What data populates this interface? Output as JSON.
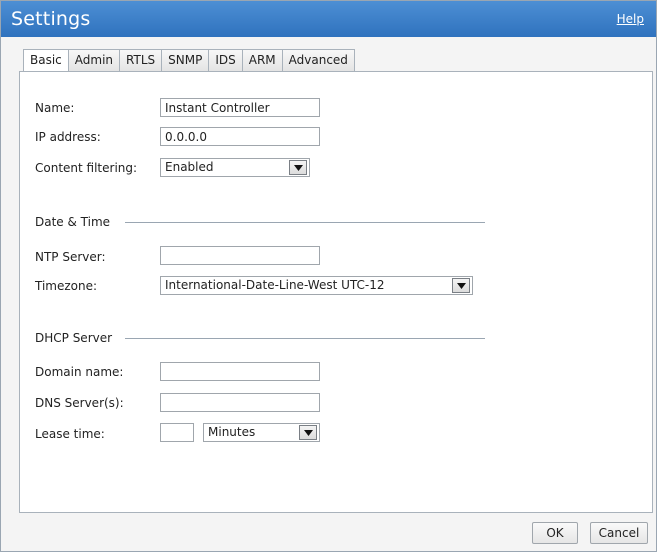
{
  "window": {
    "title": "Settings",
    "help_label": "Help"
  },
  "tabs": [
    {
      "label": "Basic",
      "active": true
    },
    {
      "label": "Admin"
    },
    {
      "label": "RTLS"
    },
    {
      "label": "SNMP"
    },
    {
      "label": "IDS"
    },
    {
      "label": "ARM"
    },
    {
      "label": "Advanced"
    }
  ],
  "basic": {
    "name_label": "Name:",
    "name_value": "Instant Controller",
    "ip_label": "IP address:",
    "ip_value": "0.0.0.0",
    "content_filtering_label": "Content filtering:",
    "content_filtering_value": "Enabled"
  },
  "date_time": {
    "section_title": "Date & Time",
    "ntp_label": "NTP Server:",
    "ntp_value": "",
    "timezone_label": "Timezone:",
    "timezone_value": "International-Date-Line-West UTC-12"
  },
  "dhcp": {
    "section_title": "DHCP Server",
    "domain_label": "Domain name:",
    "domain_value": "",
    "dns_label": "DNS Server(s):",
    "dns_value": "",
    "lease_label": "Lease time:",
    "lease_value": "",
    "lease_unit": "Minutes"
  },
  "footer": {
    "ok_label": "OK",
    "cancel_label": "Cancel"
  },
  "colors": {
    "titlebar": "#3a7fc8",
    "accent_text": "#ffffff"
  }
}
